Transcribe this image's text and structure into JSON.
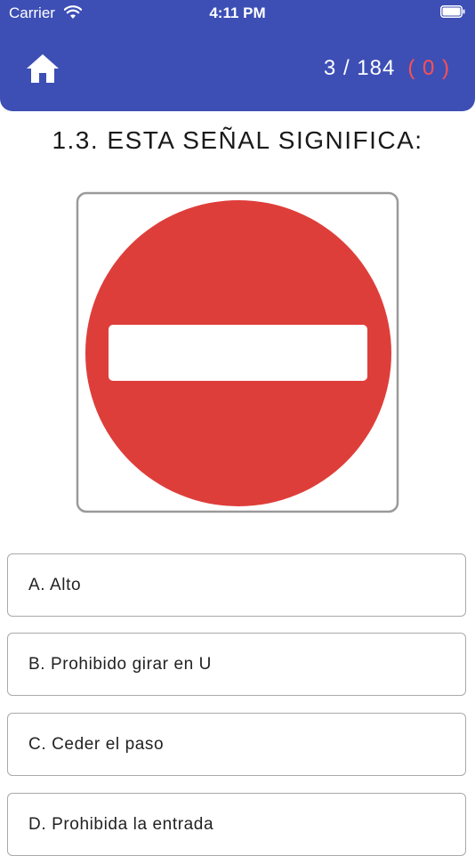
{
  "status_bar": {
    "carrier": "Carrier",
    "time": "4:11 PM"
  },
  "header": {
    "home_icon": "home-icon",
    "progress": "3 / 184",
    "wrong_count": "( 0 )",
    "colors": {
      "background": "#3d4fb5",
      "wrong": "#ff5050"
    }
  },
  "question": {
    "text": "1.3. ESTA SEÑAL SIGNIFICA:",
    "image": "do-not-enter-sign"
  },
  "options": [
    {
      "label": "A. Alto"
    },
    {
      "label": "B. Prohibido girar en U"
    },
    {
      "label": "C. Ceder el paso"
    },
    {
      "label": "D. Prohibida la entrada"
    }
  ]
}
